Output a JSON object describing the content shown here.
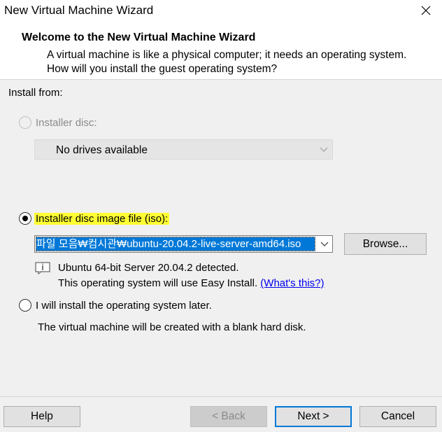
{
  "window": {
    "title": "New Virtual Machine Wizard",
    "close_glyph": "✕"
  },
  "header": {
    "title": "Welcome to the New Virtual Machine Wizard",
    "description": "A virtual machine is like a physical computer; it needs an operating system. How will you install the guest operating system?"
  },
  "install_from": {
    "label": "Install from:",
    "disc": {
      "label": "Installer disc:",
      "selected": false,
      "enabled": false,
      "dropdown_value": "No drives available"
    },
    "iso": {
      "label": "Installer disc image file (iso):",
      "selected": true,
      "path_value": "파일 모음₩컴시관₩ubuntu-20.04.2-live-server-amd64.iso",
      "browse_label": "Browse...",
      "detected_text": "Ubuntu 64-bit Server 20.04.2 detected.",
      "easy_install_text": "This operating system will use Easy Install.",
      "whats_this_link": "(What's this?)"
    },
    "later": {
      "label": "I will install the operating system later.",
      "selected": false,
      "description": "The virtual machine will be created with a blank hard disk."
    }
  },
  "footer": {
    "help_label": "Help",
    "back_label": "< Back",
    "next_label": "Next >",
    "cancel_label": "Cancel"
  },
  "colors": {
    "highlight": "#ffff33",
    "selection": "#0078d7",
    "link": "#0000ee"
  }
}
